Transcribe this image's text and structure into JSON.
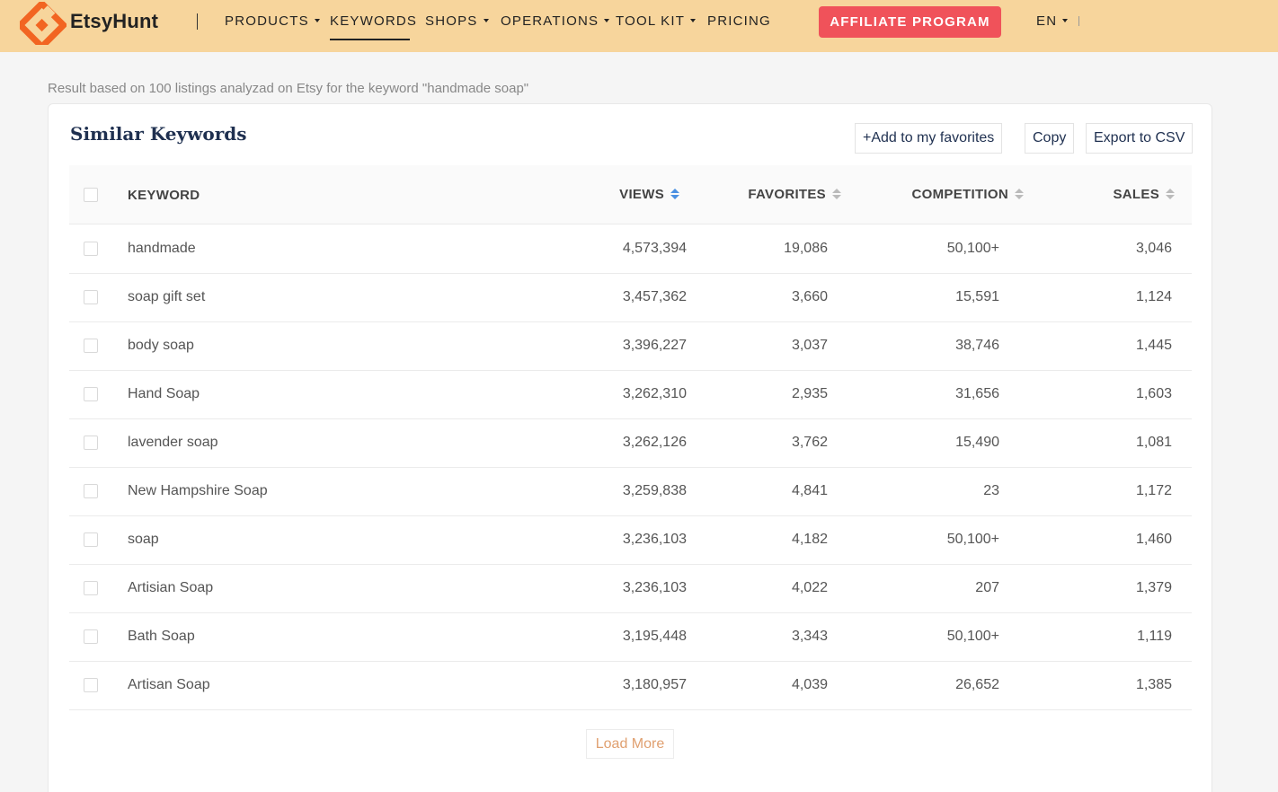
{
  "header": {
    "brand": "EtsyHunt",
    "nav": [
      {
        "label": "PRODUCTS",
        "dropdown": true
      },
      {
        "label": "KEYWORDS",
        "dropdown": false,
        "active": true
      },
      {
        "label": "SHOPS",
        "dropdown": true
      },
      {
        "label": "OPERATIONS",
        "dropdown": true
      },
      {
        "label": "TOOL KIT",
        "dropdown": true
      },
      {
        "label": "PRICING",
        "dropdown": false
      }
    ],
    "affiliate_label": "AFFILIATE PROGRAM",
    "language": "EN",
    "colors": {
      "bar": "#f7d59c",
      "logo": "#f26522",
      "affiliate": "#f0525a"
    }
  },
  "result_text": "Result based on 100 listings analyzad on Etsy for the keyword \"handmade soap\"",
  "card": {
    "title": "Similar Keywords",
    "add_favorites_label": "+Add to my favorites",
    "copy_label": "Copy",
    "export_label": "Export to CSV",
    "columns": {
      "keyword": "KEYWORD",
      "views": "VIEWS",
      "favorites": "FAVORITES",
      "competition": "COMPETITION",
      "sales": "SALES"
    },
    "sorted_column": "VIEWS",
    "rows": [
      {
        "keyword": "handmade",
        "views": "4,573,394",
        "favorites": "19,086",
        "competition": "50,100+",
        "sales": "3,046"
      },
      {
        "keyword": "soap gift set",
        "views": "3,457,362",
        "favorites": "3,660",
        "competition": "15,591",
        "sales": "1,124"
      },
      {
        "keyword": "body soap",
        "views": "3,396,227",
        "favorites": "3,037",
        "competition": "38,746",
        "sales": "1,445"
      },
      {
        "keyword": "Hand Soap",
        "views": "3,262,310",
        "favorites": "2,935",
        "competition": "31,656",
        "sales": "1,603"
      },
      {
        "keyword": "lavender soap",
        "views": "3,262,126",
        "favorites": "3,762",
        "competition": "15,490",
        "sales": "1,081"
      },
      {
        "keyword": "New Hampshire Soap",
        "views": "3,259,838",
        "favorites": "4,841",
        "competition": "23",
        "sales": "1,172"
      },
      {
        "keyword": "soap",
        "views": "3,236,103",
        "favorites": "4,182",
        "competition": "50,100+",
        "sales": "1,460"
      },
      {
        "keyword": "Artisian Soap",
        "views": "3,236,103",
        "favorites": "4,022",
        "competition": "207",
        "sales": "1,379"
      },
      {
        "keyword": "Bath Soap",
        "views": "3,195,448",
        "favorites": "3,343",
        "competition": "50,100+",
        "sales": "1,119"
      },
      {
        "keyword": "Artisan Soap",
        "views": "3,180,957",
        "favorites": "4,039",
        "competition": "26,652",
        "sales": "1,385"
      }
    ],
    "load_more_label": "Load More"
  }
}
